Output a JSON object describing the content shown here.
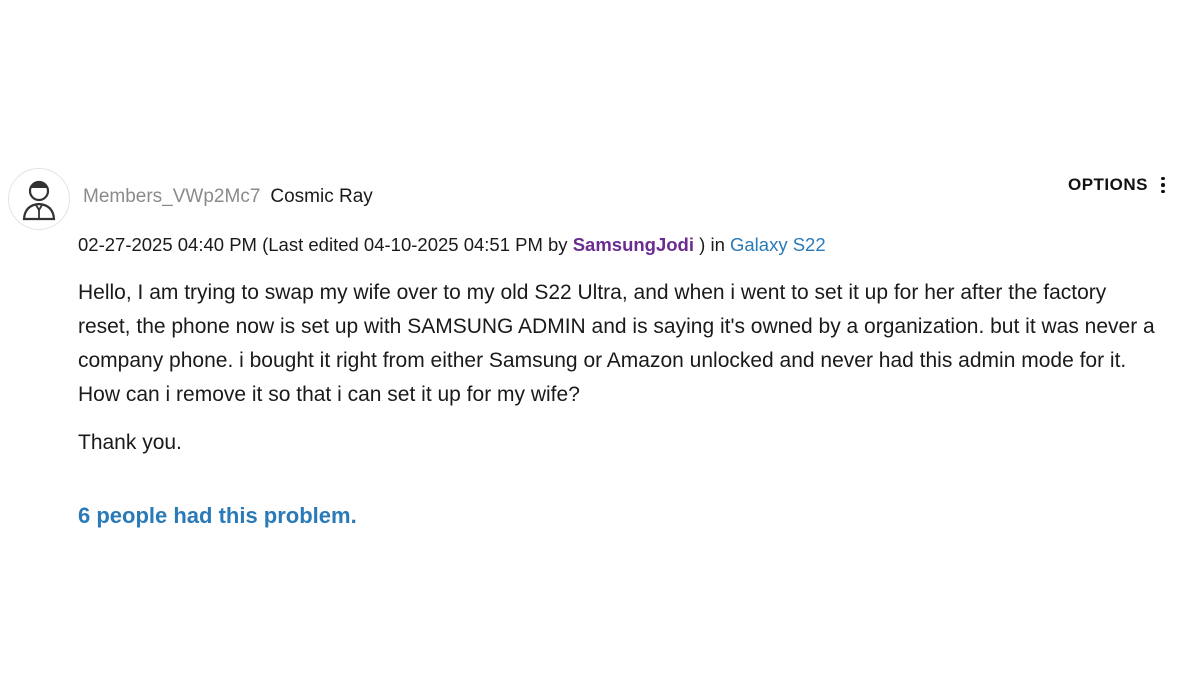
{
  "author": {
    "username": "Members_VWp2Mc7",
    "rank": "Cosmic Ray",
    "avatar_icon": "person-avatar-icon"
  },
  "options": {
    "label": "OPTIONS",
    "icon": "kebab-menu-icon"
  },
  "meta": {
    "posted": "02-27-2025 04:40 PM",
    "edited_prefix": "(Last edited 04-10-2025 04:51 PM by",
    "editor": "SamsungJodi",
    "edited_suffix": ") in",
    "board": "Galaxy S22"
  },
  "post": {
    "body": "Hello, I am trying to swap my wife over to my old S22 Ultra, and when i went to set it up for her after the factory reset, the phone now is set up with SAMSUNG ADMIN and is saying it's owned by a organization. but it was never a company phone. i bought it right from either Samsung or Amazon unlocked and never had this admin mode for it. How can i remove it so that i can set it up for my wife?",
    "closing": "Thank you."
  },
  "problem_count_text": "6 people had this problem.",
  "colors": {
    "link_blue": "#2a7ab8",
    "editor_purple": "#6a2c91",
    "username_gray": "#8a8a8a"
  }
}
